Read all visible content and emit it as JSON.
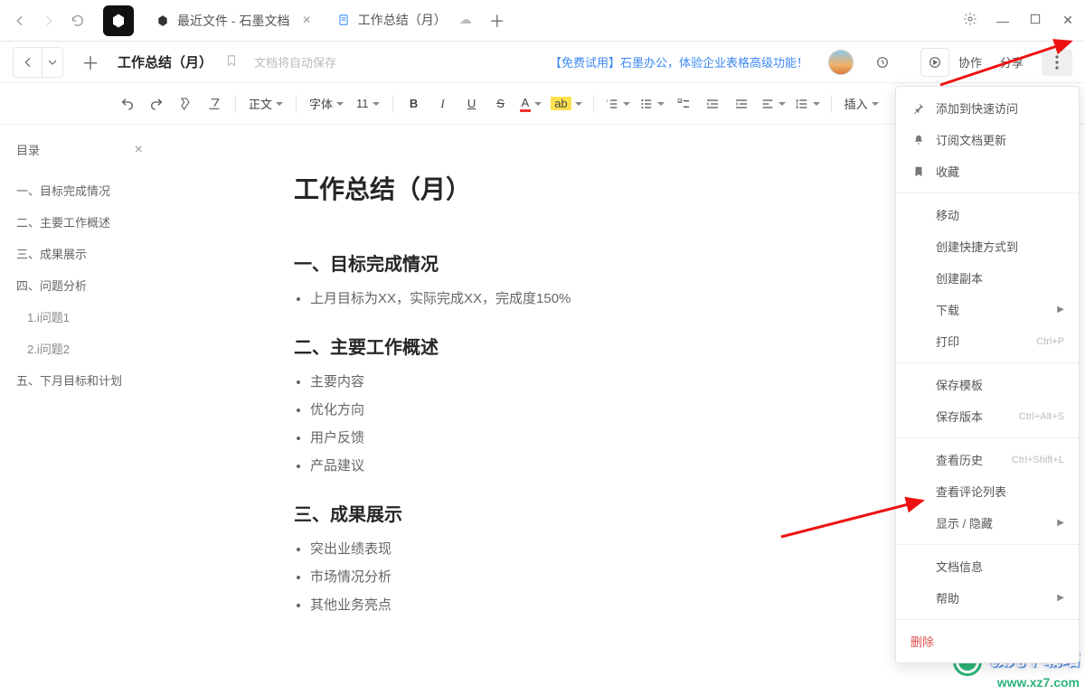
{
  "browser": {
    "tabs": [
      {
        "label": "最近文件 - 石墨文档"
      },
      {
        "label": "工作总结（月）"
      }
    ]
  },
  "header": {
    "title": "工作总结（月）",
    "save_hint": "文档将自动保存",
    "promo": "【免费试用】石墨办公，体验企业表格高级功能！",
    "collab": "协作",
    "share": "分享"
  },
  "toolbar": {
    "style_label": "正文",
    "font_label": "字体",
    "size_label": "11",
    "insert_label": "插入"
  },
  "outline": {
    "title": "目录",
    "items": [
      {
        "label": "一、目标完成情况"
      },
      {
        "label": "二、主要工作概述"
      },
      {
        "label": "三、成果展示"
      },
      {
        "label": "四、问题分析"
      },
      {
        "label": "1.i问题1",
        "sub": true
      },
      {
        "label": "2.i问题2",
        "sub": true
      },
      {
        "label": "五、下月目标和计划"
      }
    ]
  },
  "document": {
    "h1": "工作总结（月）",
    "sections": [
      {
        "heading": "一、目标完成情况",
        "bullets": [
          "上月目标为XX，实际完成XX，完成度150%"
        ]
      },
      {
        "heading": "二、主要工作概述",
        "bullets": [
          "主要内容",
          "优化方向",
          "用户反馈",
          "产品建议"
        ]
      },
      {
        "heading": "三、成果展示",
        "bullets": [
          "突出业绩表现",
          "市场情况分析",
          "其他业务亮点"
        ]
      }
    ]
  },
  "menu": {
    "g1": [
      {
        "icon": "pin",
        "label": "添加到快速访问"
      },
      {
        "icon": "bell",
        "label": "订阅文档更新"
      },
      {
        "icon": "bookmark",
        "label": "收藏"
      }
    ],
    "g2": [
      {
        "label": "移动"
      },
      {
        "label": "创建快捷方式到"
      },
      {
        "label": "创建副本"
      },
      {
        "label": "下载",
        "arrow": true
      },
      {
        "label": "打印",
        "shortcut": "Ctrl+P"
      }
    ],
    "g3": [
      {
        "label": "保存模板"
      },
      {
        "label": "保存版本",
        "shortcut": "Ctrl+Alt+S"
      }
    ],
    "g4": [
      {
        "label": "查看历史",
        "shortcut": "Ctrl+Shift+L"
      },
      {
        "label": "查看评论列表"
      },
      {
        "label": "显示 / 隐藏",
        "arrow": true
      }
    ],
    "g5": [
      {
        "label": "文档信息"
      },
      {
        "label": "帮助",
        "arrow": true
      }
    ],
    "delete_label": "删除"
  },
  "watermark": {
    "line1": "极光下载站",
    "line2": "www.xz7.com"
  },
  "help_fab": "?"
}
